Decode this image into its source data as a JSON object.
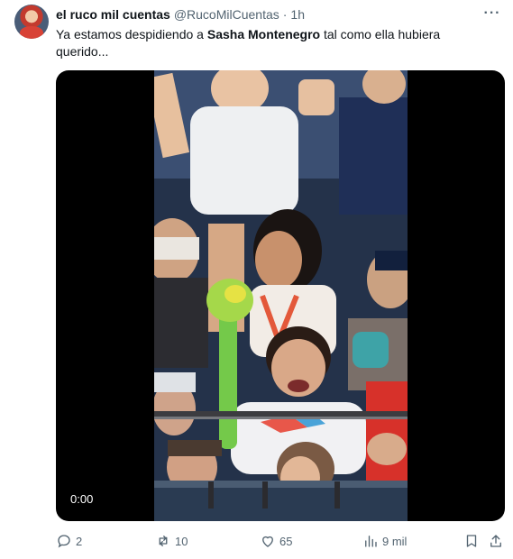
{
  "author": {
    "name": "el ruco mil cuentas",
    "handle": "@RucoMilCuentas",
    "separator": "·",
    "time": "1h"
  },
  "menu_icon": "more-horizontal-icon",
  "menu_glyph": "···",
  "tweet": {
    "text_before": "Ya estamos despidiendo a ",
    "text_bold": "Sasha Montenegro",
    "text_after": " tal como ella hubiera querido..."
  },
  "video": {
    "timecode": "0:00"
  },
  "actions": {
    "replies": "2",
    "retweets": "10",
    "likes": "65",
    "views": "9 mil"
  },
  "colors": {
    "text_primary": "#0f1419",
    "text_secondary": "#536471",
    "video_bg": "#000000"
  }
}
